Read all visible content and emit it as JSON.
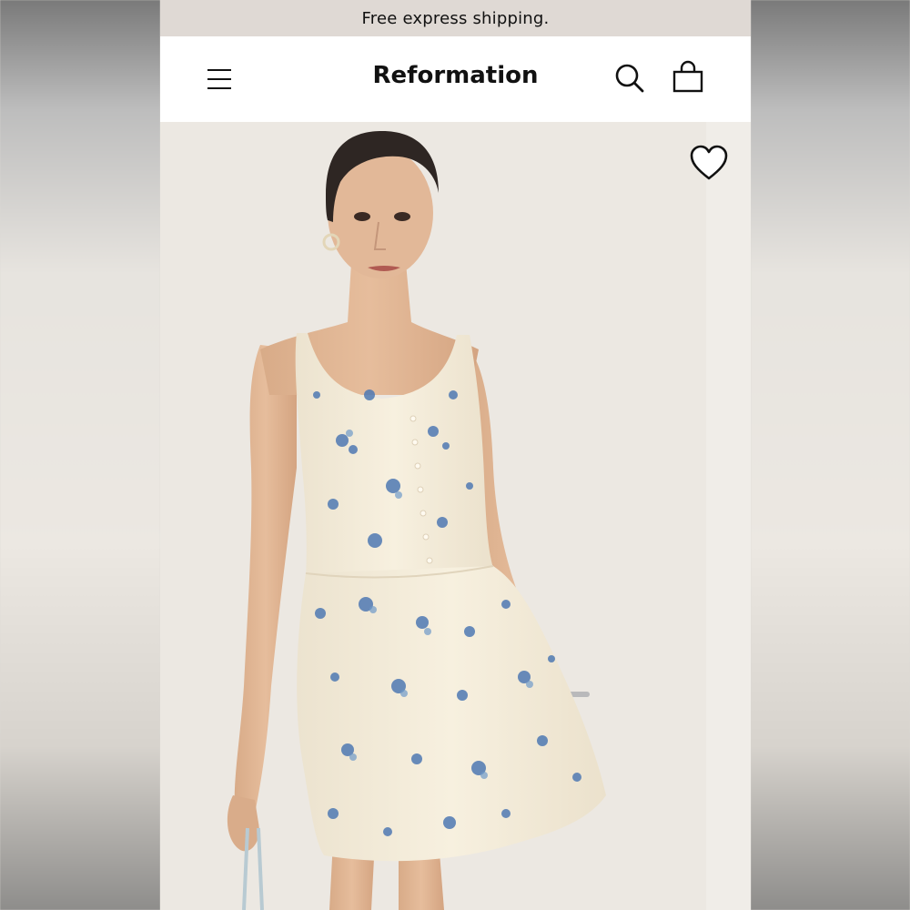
{
  "banner": {
    "text": "Free express shipping."
  },
  "header": {
    "logo": "Reformation",
    "menu_icon": "hamburger-menu-icon",
    "search_icon": "search-icon",
    "bag_icon": "shopping-bag-icon"
  },
  "product": {
    "image_alt": "Model wearing cream sleeveless mini dress with blue floral print",
    "wishlist_icon": "heart-icon"
  },
  "colors": {
    "banner_bg": "#dfd9d4",
    "header_bg": "#ffffff",
    "dress": "#f4ecda",
    "floral": "#4f79b3",
    "skin": "#e0b595"
  }
}
